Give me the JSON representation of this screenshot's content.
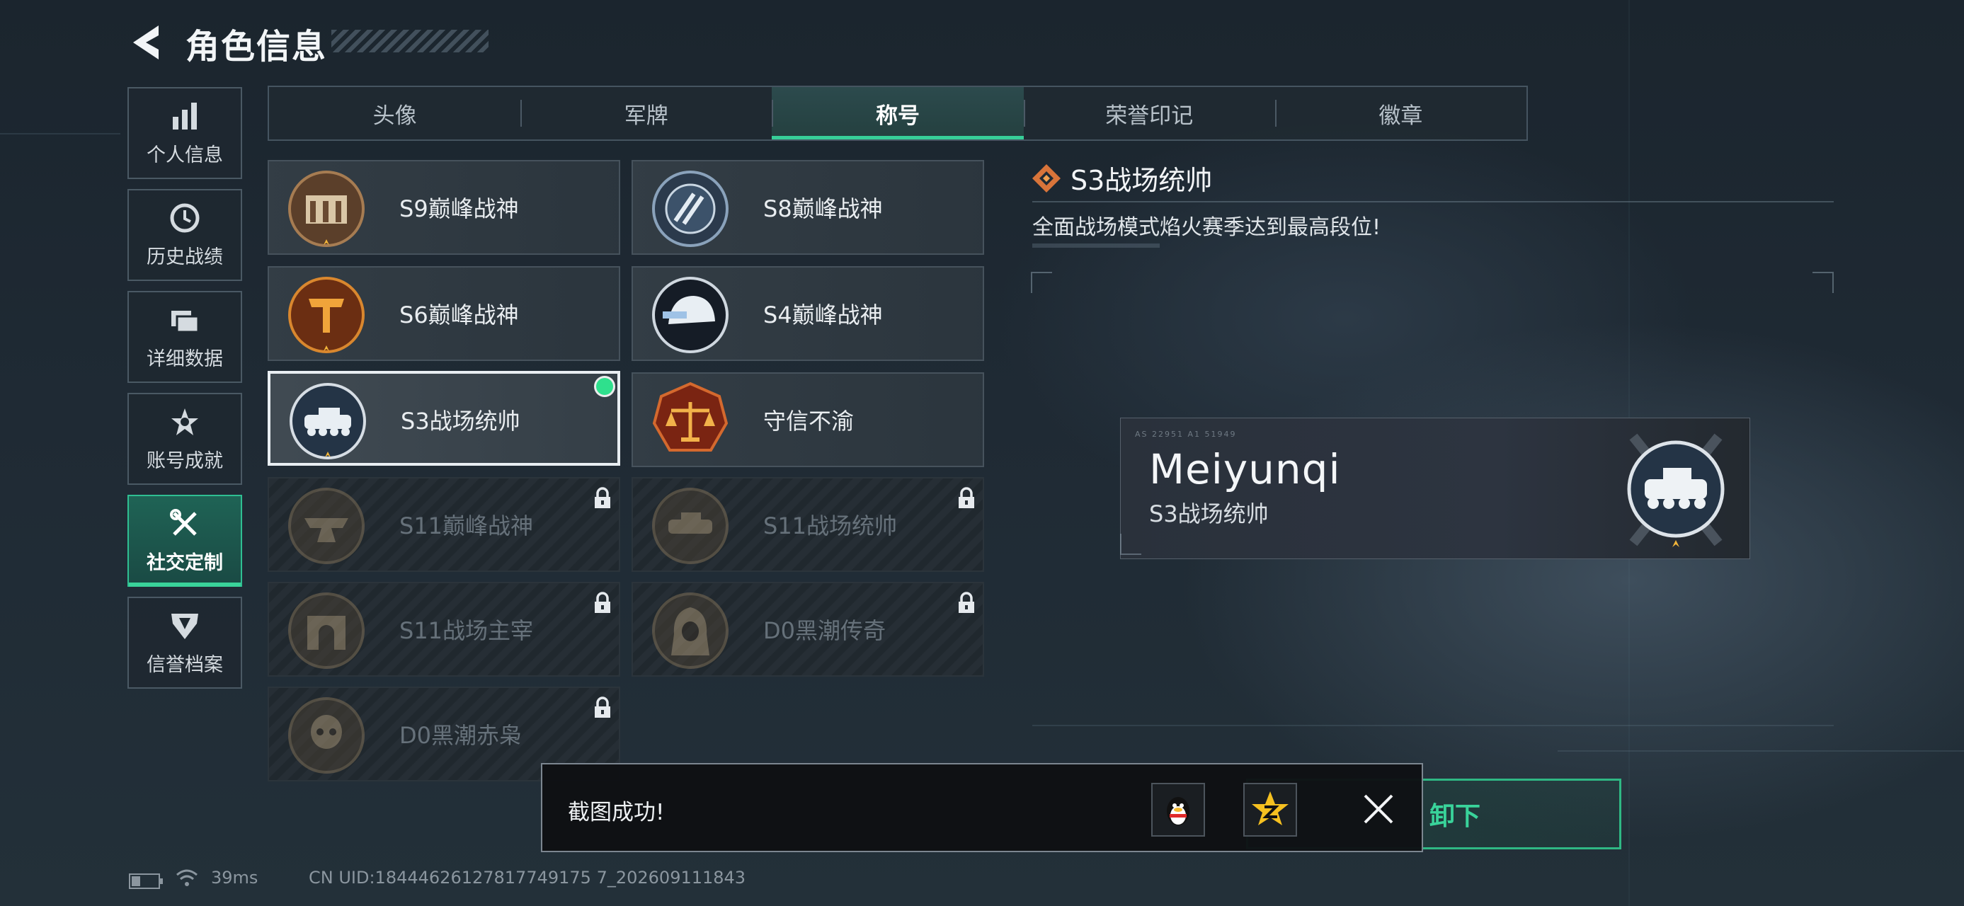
{
  "header": {
    "title": "角色信息"
  },
  "nav": [
    {
      "label": "个人信息",
      "icon": "bar-chart-icon",
      "active": false
    },
    {
      "label": "历史战绩",
      "icon": "clock-icon",
      "active": false
    },
    {
      "label": "详细数据",
      "icon": "folder-icon",
      "active": false
    },
    {
      "label": "账号成就",
      "icon": "achievement-star-icon",
      "active": false
    },
    {
      "label": "社交定制",
      "icon": "tools-icon",
      "active": true
    },
    {
      "label": "信誉档案",
      "icon": "shield-badge-icon",
      "active": false
    }
  ],
  "tabs": [
    {
      "label": "头像",
      "active": false
    },
    {
      "label": "军牌",
      "active": false
    },
    {
      "label": "称号",
      "active": true
    },
    {
      "label": "荣誉印记",
      "active": false
    },
    {
      "label": "徽章",
      "active": false
    }
  ],
  "titles": [
    {
      "label": "S9巅峰战神",
      "emblem": "building-emblem-icon",
      "locked": false,
      "selected": false,
      "equipped": false
    },
    {
      "label": "S8巅峰战神",
      "emblem": "stripes-emblem-icon",
      "locked": false,
      "selected": false,
      "equipped": false
    },
    {
      "label": "S6巅峰战神",
      "emblem": "t-crest-emblem-icon",
      "locked": false,
      "selected": false,
      "equipped": false
    },
    {
      "label": "S4巅峰战神",
      "emblem": "helmet-emblem-icon",
      "locked": false,
      "selected": false,
      "equipped": false
    },
    {
      "label": "S3战场统帅",
      "emblem": "tank-emblem-icon",
      "locked": false,
      "selected": true,
      "equipped": true
    },
    {
      "label": "守信不渝",
      "emblem": "scales-emblem-icon",
      "locked": false,
      "selected": false,
      "equipped": false
    },
    {
      "label": "S11巅峰战神",
      "emblem": "anvil-emblem-icon",
      "locked": true,
      "selected": false,
      "equipped": false
    },
    {
      "label": "S11战场统帅",
      "emblem": "tank-emblem-icon",
      "locked": true,
      "selected": false,
      "equipped": false
    },
    {
      "label": "S11战场主宰",
      "emblem": "arch-emblem-icon",
      "locked": true,
      "selected": false,
      "equipped": false
    },
    {
      "label": "D0黑潮传奇",
      "emblem": "hooded-figure-emblem-icon",
      "locked": true,
      "selected": false,
      "equipped": false
    },
    {
      "label": "D0黑潮赤枭",
      "emblem": "skull-emblem-icon",
      "locked": true,
      "selected": false,
      "equipped": false
    }
  ],
  "detail": {
    "title": "S3战场统帅",
    "description": "全面战场模式焰火赛季达到最高段位!"
  },
  "nameplate": {
    "player_name": "Meiyunqi",
    "title": "S3战场统帅",
    "fine_print": "AS 22951  A1 51949"
  },
  "action_button": {
    "label": "卸下"
  },
  "toast": {
    "message": "截图成功!",
    "share_targets": [
      "qq-penguin-icon",
      "qzone-star-icon"
    ]
  },
  "status_bar": {
    "ping": "39ms",
    "uid": "CN UID:18444626127817749175 7_202609111843"
  },
  "colors": {
    "accent": "#37cf98",
    "equipped": "#2fe08d",
    "background": "#1f2a34"
  }
}
